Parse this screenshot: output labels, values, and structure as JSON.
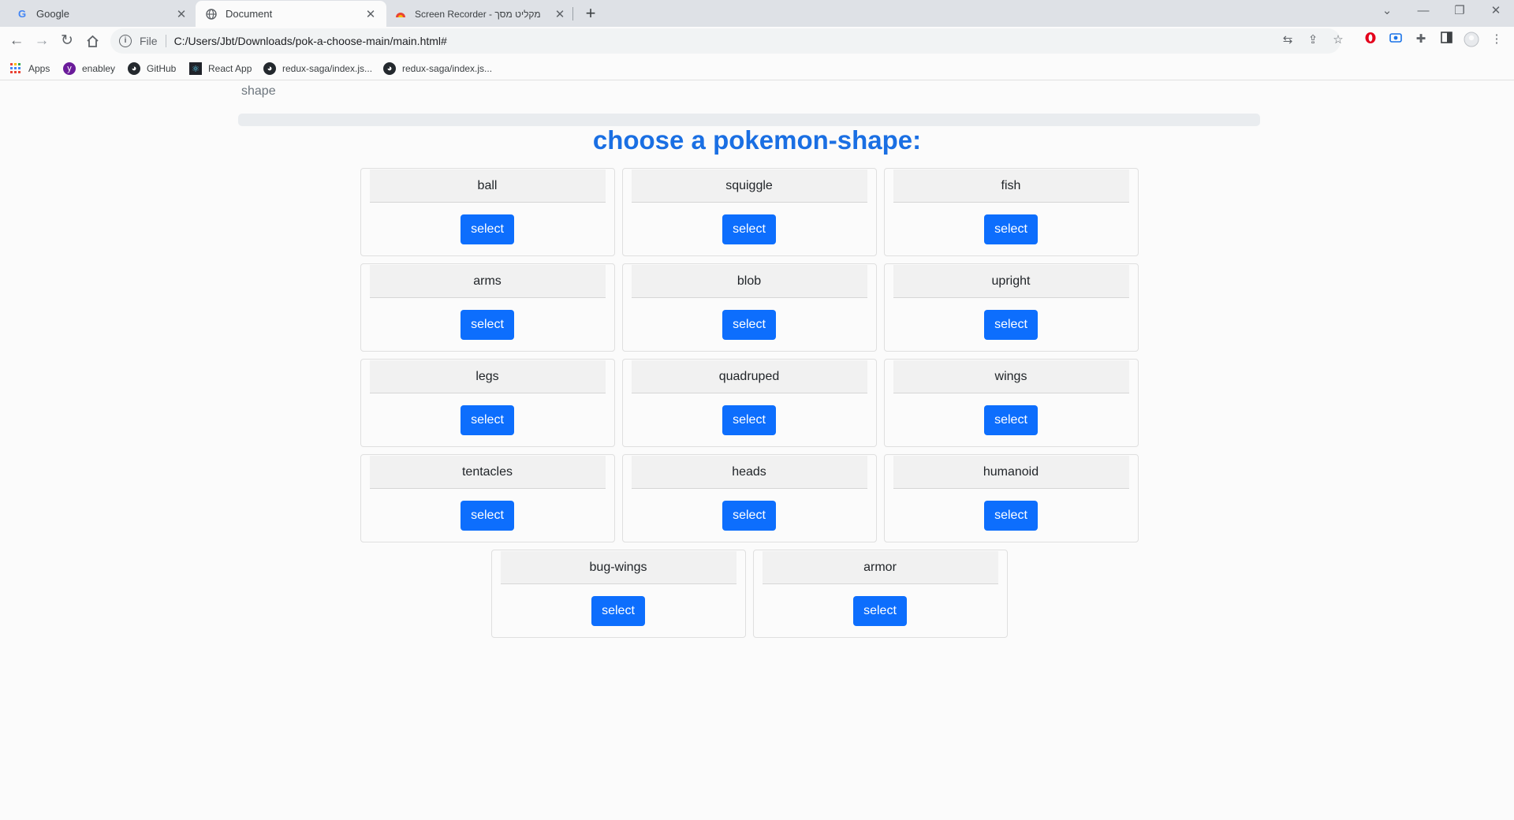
{
  "browser": {
    "tabs": [
      {
        "title": "Google",
        "icon": "google-icon"
      },
      {
        "title": "Document",
        "icon": "globe-icon"
      },
      {
        "title": "Screen Recorder - מקליט מסך",
        "icon": "recorder-icon"
      }
    ],
    "address": {
      "scheme": "File",
      "url": "C:/Users/Jbt/Downloads/pok-a-choose-main/main.html#"
    },
    "bookmarks": [
      {
        "label": "Apps",
        "icon": "apps-grid-icon"
      },
      {
        "label": "enabley",
        "icon": "enabley-icon"
      },
      {
        "label": "GitHub",
        "icon": "github-icon"
      },
      {
        "label": "React App",
        "icon": "react-icon"
      },
      {
        "label": "redux-saga/index.js...",
        "icon": "github-icon"
      },
      {
        "label": "redux-saga/index.js...",
        "icon": "github-icon"
      }
    ]
  },
  "page": {
    "step_label": "shape",
    "progress_fraction": 0.0,
    "heading": "choose a pokemon-shape:",
    "button_label": "select",
    "shapes": [
      "ball",
      "squiggle",
      "fish",
      "arms",
      "blob",
      "upright",
      "legs",
      "quadruped",
      "wings",
      "tentacles",
      "heads",
      "humanoid",
      "bug-wings",
      "armor"
    ]
  },
  "colors": {
    "accent": "#0d6efd",
    "heading": "#1a6fe3"
  }
}
